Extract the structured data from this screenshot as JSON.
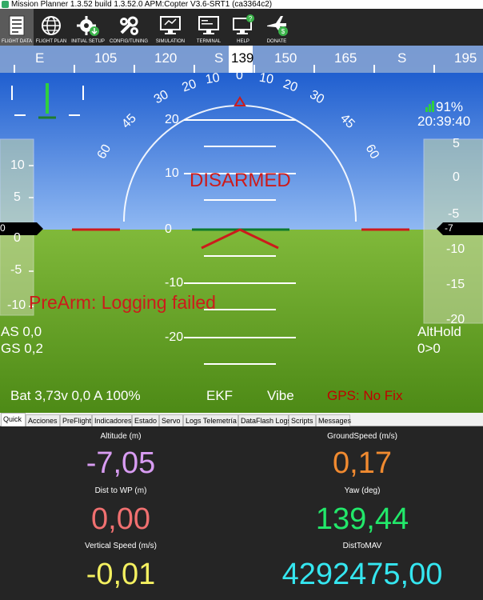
{
  "window": {
    "title": "Mission Planner 1.3.52 build 1.3.52.0 APM:Copter V3.6-SRT1 (ca3364c2)"
  },
  "menu": [
    {
      "label": "FLIGHT DATA",
      "icon": "flight-data-icon"
    },
    {
      "label": "FLIGHT PLAN",
      "icon": "globe-icon"
    },
    {
      "label": "INITIAL SETUP",
      "icon": "gear-download-icon"
    },
    {
      "label": "CONFIG/TUNING",
      "icon": "wrench-gear-icon"
    },
    {
      "label": "SIMULATION",
      "icon": "monitor-icon"
    },
    {
      "label": "TERMINAL",
      "icon": "terminal-icon"
    },
    {
      "label": "HELP",
      "icon": "help-icon"
    },
    {
      "label": "DONATE",
      "icon": "plane-dollar-icon"
    }
  ],
  "hud": {
    "heading": {
      "current": "139",
      "labels": [
        "E",
        "105",
        "120",
        "S",
        "150",
        "165",
        "S",
        "195"
      ]
    },
    "roll_labels": [
      "60",
      "45",
      "30",
      "20",
      "10",
      "0",
      "10",
      "20",
      "30",
      "45",
      "60"
    ],
    "pitch_labels": [
      "20",
      "10",
      "0",
      "-10",
      "-20"
    ],
    "speed_labels": [
      "10",
      "5",
      "0",
      "-5",
      "-10"
    ],
    "speed_readout": "0",
    "alt_labels": [
      "5",
      "0",
      "-5",
      "-10",
      "-15",
      "-20"
    ],
    "alt_readout": "-7",
    "status": "DISARMED",
    "message": "PreArm: Logging failed",
    "airspeed": "AS 0,0",
    "groundspeed": "GS 0,2",
    "mode": "AltHold",
    "wp": "0>0",
    "link_quality": "91%",
    "time": "20:39:40",
    "battery": "Bat 3,73v 0,0 A 100%",
    "ekf": "EKF",
    "vibe": "Vibe",
    "gps": "GPS: No Fix",
    "colors": {
      "sky": "#1d6fe0",
      "ground": "#6ca628",
      "warn": "#cc1b1b",
      "gps": "#c00000"
    }
  },
  "tabs": [
    "Quick",
    "Acciones",
    "PreFlight",
    "Indicadores",
    "Estado",
    "Servo",
    "Logs Telemetría",
    "DataFlash Logs",
    "Scripts",
    "Messages"
  ],
  "quick": [
    {
      "label": "Altitude (m)",
      "value": "-7,05",
      "color": "#d89cf2"
    },
    {
      "label": "GroundSpeed (m/s)",
      "value": "0,17",
      "color": "#f08a30"
    },
    {
      "label": "Dist to WP (m)",
      "value": "0,00",
      "color": "#f07070"
    },
    {
      "label": "Yaw (deg)",
      "value": "139,44",
      "color": "#22e86a"
    },
    {
      "label": "Vertical Speed (m/s)",
      "value": "-0,01",
      "color": "#f4f060"
    },
    {
      "label": "DistToMAV",
      "value": "4292475,00",
      "color": "#35e6f0"
    }
  ]
}
